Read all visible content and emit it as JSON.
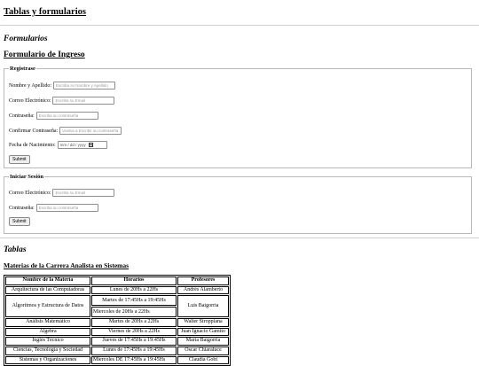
{
  "page": {
    "title": "Tablas y formularios"
  },
  "forms_section": {
    "heading": "Formularios",
    "subheading": "Formulario de Ingreso",
    "register": {
      "legend": "Registrase",
      "fields": [
        {
          "label": "Nombre y Apellido:",
          "placeholder": "Escriba su Nombre y Apellido"
        },
        {
          "label": "Correo Electrónico:",
          "placeholder": "Escriba su Email"
        },
        {
          "label": "Contraseña:",
          "placeholder": "Escriba su contraseña"
        },
        {
          "label": "Confirmar Contraseña:",
          "placeholder": "Vuelva a Escribir su contraseña"
        },
        {
          "label": "Fecha de Nacimiento:",
          "placeholder": "mm / dd / yyyy"
        }
      ],
      "submit_label": "Submit"
    },
    "login": {
      "legend": "Iniciar Sesión",
      "fields": [
        {
          "label": "Correo Electrónico:",
          "placeholder": "Escriba su Email"
        },
        {
          "label": "Contraseña:",
          "placeholder": "Escriba su contraseña"
        }
      ],
      "submit_label": "Submit"
    }
  },
  "tables_section": {
    "heading": "Tablas",
    "subheading": "Materias de la Carrera Analista en Sistemas",
    "table": {
      "headers": [
        "Nombre de la Materia",
        "Horarios",
        "Profesores"
      ],
      "rows": [
        {
          "materia": "Arquitectura de las Computadoras",
          "horario": "Lunes de 20Hs a 22Hs",
          "profesor": "Andrés Alamberto"
        },
        {
          "materia": "Algoritmos y Estructura de Datos",
          "horario_1": "Martes de 17:45Hs a 19:45Hs",
          "horario_2": "Miercoles de 20Hs a 22Hs",
          "profesor": "Luis Baigorria"
        },
        {
          "materia": "Análisis Matemático",
          "horario": "Martes de 20Hs a 22Hs",
          "profesor": "Walter Stroppiana"
        },
        {
          "materia": "Algebra",
          "horario": "Viernes de 20Hs a 22Hs",
          "profesor": "Juan Ignacio Gamito"
        },
        {
          "materia": "Inglés Técnico",
          "horario": "Jueves de 17:45Hs a 19:45Hs",
          "profesor": "María Baigorria"
        },
        {
          "materia": "Ciencias, Tecnología y Sociedad",
          "horario": "Lunes de 17:45Hs a 19:45Hs",
          "profesor": "Oscar Chiaraluce"
        },
        {
          "materia": "Sistemas y Organizaciones",
          "horario": "Miercoles DE 17:45Hs a 19:45Hs",
          "profesor": "Claudia Gobi"
        }
      ]
    }
  }
}
